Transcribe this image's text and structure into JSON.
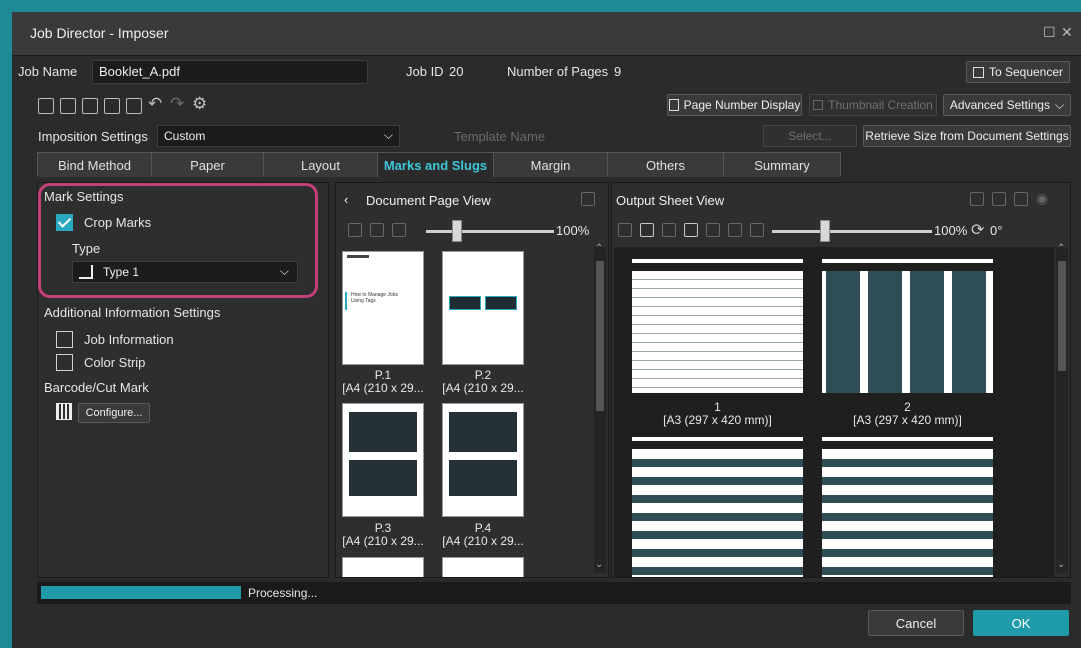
{
  "window": {
    "title": "Job Director - Imposer"
  },
  "job": {
    "name_label": "Job Name",
    "name_value": "Booklet_A.pdf",
    "id_label": "Job ID",
    "id_value": "20",
    "pages_label": "Number of Pages",
    "pages_value": "9",
    "to_sequencer": "To Sequencer"
  },
  "toolbar": {
    "page_number_display": "Page Number Display",
    "thumbnail_creation": "Thumbnail Creation",
    "advanced_settings": "Advanced Settings"
  },
  "imposition": {
    "label": "Imposition Settings",
    "value": "Custom",
    "template_label": "Template Name",
    "select_button": "Select...",
    "retrieve_button": "Retrieve Size from Document Settings"
  },
  "tabs": [
    {
      "label": "Bind Method"
    },
    {
      "label": "Paper"
    },
    {
      "label": "Layout"
    },
    {
      "label": "Marks and Slugs"
    },
    {
      "label": "Margin"
    },
    {
      "label": "Others"
    },
    {
      "label": "Summary"
    }
  ],
  "settings": {
    "mark_settings": "Mark Settings",
    "crop_marks": "Crop Marks",
    "type_label": "Type",
    "type_value": "Type 1",
    "additional_info": "Additional Information Settings",
    "job_information": "Job Information",
    "color_strip": "Color Strip",
    "barcode_cut": "Barcode/Cut Mark",
    "configure": "Configure..."
  },
  "document_view": {
    "title": "Document Page View",
    "zoom": "100%",
    "pages": [
      {
        "num": "P.1",
        "size": "[A4 (210 x 29..."
      },
      {
        "num": "P.2",
        "size": "[A4 (210 x 29..."
      },
      {
        "num": "P.3",
        "size": "[A4 (210 x 29..."
      },
      {
        "num": "P.4",
        "size": "[A4 (210 x 29..."
      }
    ],
    "p1_text": [
      "How to Manage Jobs",
      "Using Tags"
    ]
  },
  "output_view": {
    "title": "Output Sheet View",
    "zoom": "100%",
    "rotation": "0°",
    "sheets": [
      {
        "num": "1",
        "size": "[A3 (297 x 420 mm)]"
      },
      {
        "num": "2",
        "size": "[A3 (297 x 420 mm)]"
      }
    ]
  },
  "status": {
    "text": "Processing...",
    "progress": 0.2
  },
  "footer": {
    "cancel": "Cancel",
    "ok": "OK"
  },
  "colors": {
    "accent": "#2aa8c0",
    "highlight_ring": "#c4407a",
    "teal_frame": "#1e8a96"
  }
}
